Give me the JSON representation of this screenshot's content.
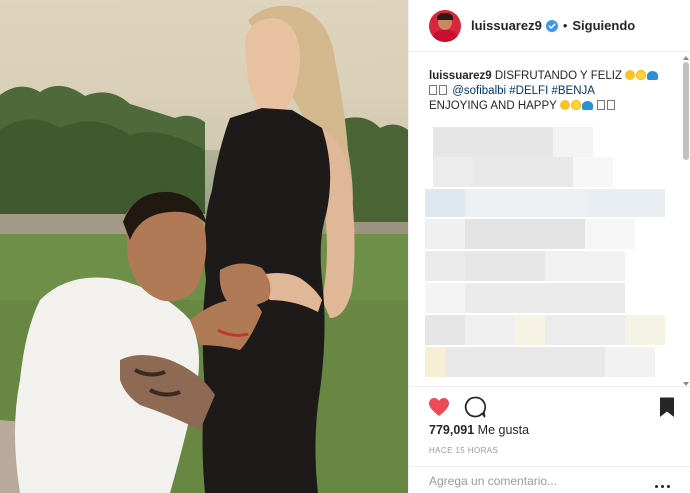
{
  "header": {
    "username": "luissuarez9",
    "separator": "•",
    "follow_status": "Siguiendo",
    "avatar_icon": "profile-avatar",
    "verified_icon": "verified-badge-icon"
  },
  "caption": {
    "username": "luissuarez9",
    "line1_text": "DISFRUTANDO Y FELIZ",
    "line2_mentions": [
      "@sofibalbi",
      "#DELFI",
      "#BENJA"
    ],
    "line3_text": "ENJOYING AND HAPPY",
    "emojis": [
      "smiling-face",
      "sun",
      "water-wave"
    ]
  },
  "actions": {
    "like_icon": "heart-icon",
    "like_color": "#ed4956",
    "comment_icon": "speech-bubble-icon",
    "save_icon": "bookmark-icon"
  },
  "stats": {
    "likes_count": "779,091",
    "likes_label": "Me gusta",
    "timestamp": "HACE 15 HORAS"
  },
  "comment": {
    "placeholder": "Agrega un comentario...",
    "more_icon": "more-options-icon"
  },
  "colors": {
    "link": "#003569",
    "text": "#262626",
    "muted": "#999999",
    "verified": "#3897f0"
  }
}
